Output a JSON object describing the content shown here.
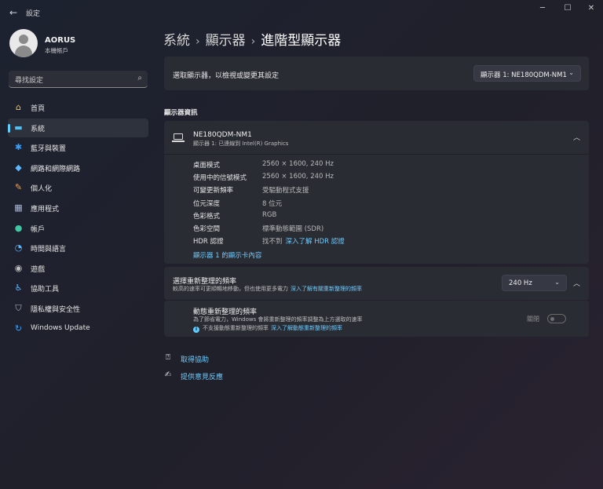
{
  "window": {
    "title": "設定",
    "back_glyph": "←",
    "minimize_glyph": "─",
    "maximize_glyph": "☐",
    "close_glyph": "✕"
  },
  "profile": {
    "name": "AORUS",
    "account_type": "本機帳戶"
  },
  "search": {
    "placeholder": "尋找設定",
    "icon": "search-icon",
    "icon_glyph": "⌕"
  },
  "sidebar": {
    "accent_color": "#60cdff",
    "items": [
      {
        "label": "首頁",
        "icon": "home-icon",
        "glyph": "⌂",
        "color": "#f2c15c",
        "selected": false
      },
      {
        "label": "系統",
        "icon": "system-icon",
        "glyph": "▬",
        "color": "#4cc2ff",
        "selected": true
      },
      {
        "label": "藍牙與裝置",
        "icon": "bluetooth-icon",
        "glyph": "✱",
        "color": "#3aa0ff",
        "selected": false
      },
      {
        "label": "網路和網際網路",
        "icon": "wifi-icon",
        "glyph": "◆",
        "color": "#5fb7ff",
        "selected": false
      },
      {
        "label": "個人化",
        "icon": "brush-icon",
        "glyph": "✎",
        "color": "#f0a35a",
        "selected": false
      },
      {
        "label": "應用程式",
        "icon": "apps-icon",
        "glyph": "▦",
        "color": "#a9b8d6",
        "selected": false
      },
      {
        "label": "帳戶",
        "icon": "account-icon",
        "glyph": "●",
        "color": "#3fc7a4",
        "selected": false
      },
      {
        "label": "時間與語言",
        "icon": "globe-clock-icon",
        "glyph": "◔",
        "color": "#5fb7ff",
        "selected": false
      },
      {
        "label": "遊戲",
        "icon": "gamepad-icon",
        "glyph": "◉",
        "color": "#c0c0c0",
        "selected": false
      },
      {
        "label": "協助工具",
        "icon": "accessibility-icon",
        "glyph": "♿",
        "color": "#5fb7ff",
        "selected": false
      },
      {
        "label": "隱私權與安全性",
        "icon": "shield-icon",
        "glyph": "⛉",
        "color": "#b0b8c8",
        "selected": false
      },
      {
        "label": "Windows Update",
        "icon": "update-icon",
        "glyph": "↻",
        "color": "#3aa0ff",
        "selected": false
      }
    ]
  },
  "breadcrumb": {
    "items": [
      "系統",
      "顯示器",
      "進階型顯示器"
    ],
    "separator": "›"
  },
  "display_select": {
    "label": "選取顯示器，以檢視或變更其設定",
    "value": "顯示器 1: NE180QDM-NM1",
    "chevron": "⌄"
  },
  "info_section": {
    "title": "顯示器資訊",
    "monitor_name": "NE180QDM-NM1",
    "monitor_sub": "顯示器 1: 已連線到 Intel(R) Graphics",
    "collapse_glyph": "︿",
    "rows": [
      {
        "key": "桌面模式",
        "value": "2560 × 1600, 240 Hz",
        "link": ""
      },
      {
        "key": "使用中的信號模式",
        "value": "2560 × 1600, 240 Hz",
        "link": ""
      },
      {
        "key": "可變更新頻率",
        "value": "受驅動程式支援",
        "link": ""
      },
      {
        "key": "位元深度",
        "value": "8 位元",
        "link": ""
      },
      {
        "key": "色彩格式",
        "value": "RGB",
        "link": ""
      },
      {
        "key": "色彩空間",
        "value": "標準動態範圍 (SDR)",
        "link": ""
      },
      {
        "key": "HDR 認證",
        "value": "找不到",
        "link": "深入了解 HDR 認證"
      }
    ],
    "adapter_link": "顯示器 1 的顯示卡內容"
  },
  "refresh_rate": {
    "title": "選擇重新整理的頻率",
    "subtitle": "較高的速率可更順暢地移動，但也使用更多電力",
    "link": "深入了解有關重新整理的頻率",
    "value": "240 Hz",
    "chevron": "⌄",
    "collapse_glyph": "︿"
  },
  "dynamic_refresh": {
    "title": "動態重新整理的頻率",
    "subtitle": "為了節省電力，Windows 會將重新整理的頻率調整為上方選取的速率",
    "note": "不支援動態重新整理的頻率",
    "note_link": "深入了解動態重新整理的頻率",
    "info_glyph": "i",
    "toggle_label": "關閉",
    "toggle_on": false
  },
  "help": {
    "items": [
      {
        "label": "取得協助",
        "icon": "help-chat-icon",
        "glyph": "⍰"
      },
      {
        "label": "提供意見反應",
        "icon": "feedback-icon",
        "glyph": "✍"
      }
    ]
  }
}
